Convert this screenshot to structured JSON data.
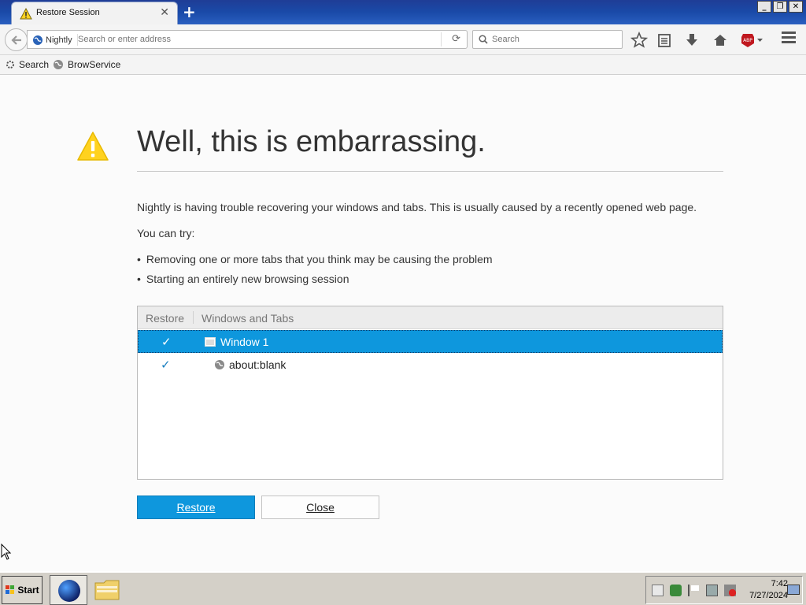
{
  "browser": {
    "tab_title": "Restore Session",
    "identity_label": "Nightly",
    "url_placeholder": "Search or enter address",
    "search_placeholder": "Search",
    "window_controls": [
      "_",
      "❐",
      "✕"
    ]
  },
  "bookmarks": [
    {
      "label": "Search"
    },
    {
      "label": "BrowService"
    }
  ],
  "page": {
    "heading": "Well, this is embarrassing.",
    "description": "Nightly is having trouble recovering your windows and tabs. This is usually caused by a recently opened web page.",
    "try_label": "You can try:",
    "suggestions": [
      "Removing one or more tabs that you think may be causing the problem",
      "Starting an entirely new browsing session"
    ],
    "tree": {
      "col_restore": "Restore",
      "col_windows": "Windows and Tabs",
      "rows": [
        {
          "checked": true,
          "label": "Window 1",
          "selected": true
        },
        {
          "checked": true,
          "label": "about:blank",
          "selected": false
        }
      ]
    },
    "restore_button": "Restore",
    "close_button": "Close"
  },
  "taskbar": {
    "start_label": "Start",
    "clock_time": "7:42",
    "clock_date": "7/27/2024"
  },
  "colors": {
    "accent": "#0e97dd",
    "title_bar": "#1f3d96",
    "warning": "#ffd21f"
  }
}
